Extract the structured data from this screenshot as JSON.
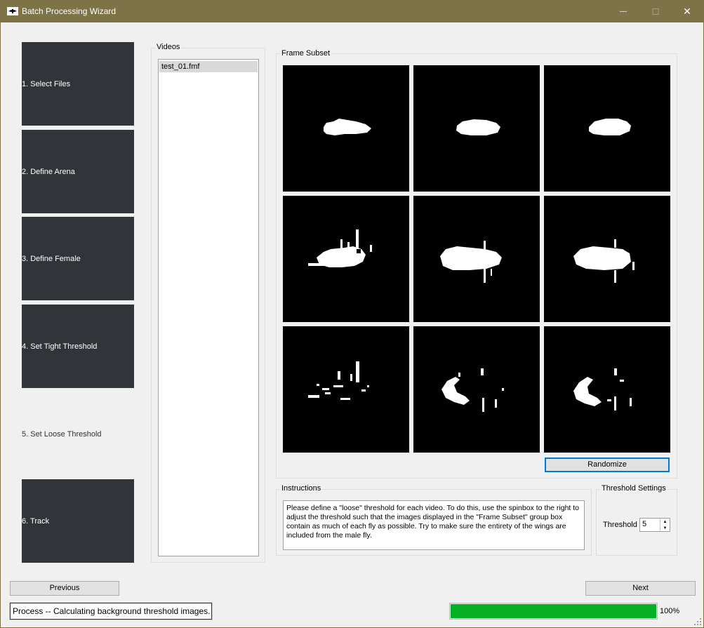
{
  "window": {
    "title": "Batch Processing Wizard"
  },
  "title_buttons": {
    "minimize": "—",
    "maximize": "☐",
    "close": "✕"
  },
  "steps": [
    {
      "label": "1. Select Files",
      "active": false
    },
    {
      "label": "2. Define Arena",
      "active": false
    },
    {
      "label": "3. Define Female",
      "active": false
    },
    {
      "label": "4. Set Tight Threshold",
      "active": false
    },
    {
      "label": "5. Set Loose Threshold",
      "active": true
    },
    {
      "label": "6. Track",
      "active": false
    }
  ],
  "videos": {
    "title": "Videos",
    "items": [
      "test_01.fmf"
    ],
    "selected_index": 0
  },
  "frame_subset": {
    "title": "Frame Subset",
    "frame_count": 9,
    "randomize_label": "Randomize"
  },
  "instructions": {
    "title": "Instructions",
    "text": "Please define a \"loose\" threshold for each video. To do this, use the spinbox to the right to adjust the threshold such that the images displayed in the \"Frame Subset\" group box contain as much of each fly as possible. Try to make sure the entirety of the wings are included from the male fly."
  },
  "threshold_settings": {
    "title": "Threshold Settings",
    "label": "Threshold",
    "value": "5"
  },
  "navigation": {
    "previous": "Previous",
    "next": "Next"
  },
  "status": {
    "message": "Process -- Calculating background threshold images.",
    "progress_percent": 100,
    "progress_text": "100%",
    "progress_color": "#06b025"
  },
  "colors": {
    "titlebar": "#7d7347",
    "step_bg": "#31353a",
    "focus": "#0078d7"
  }
}
